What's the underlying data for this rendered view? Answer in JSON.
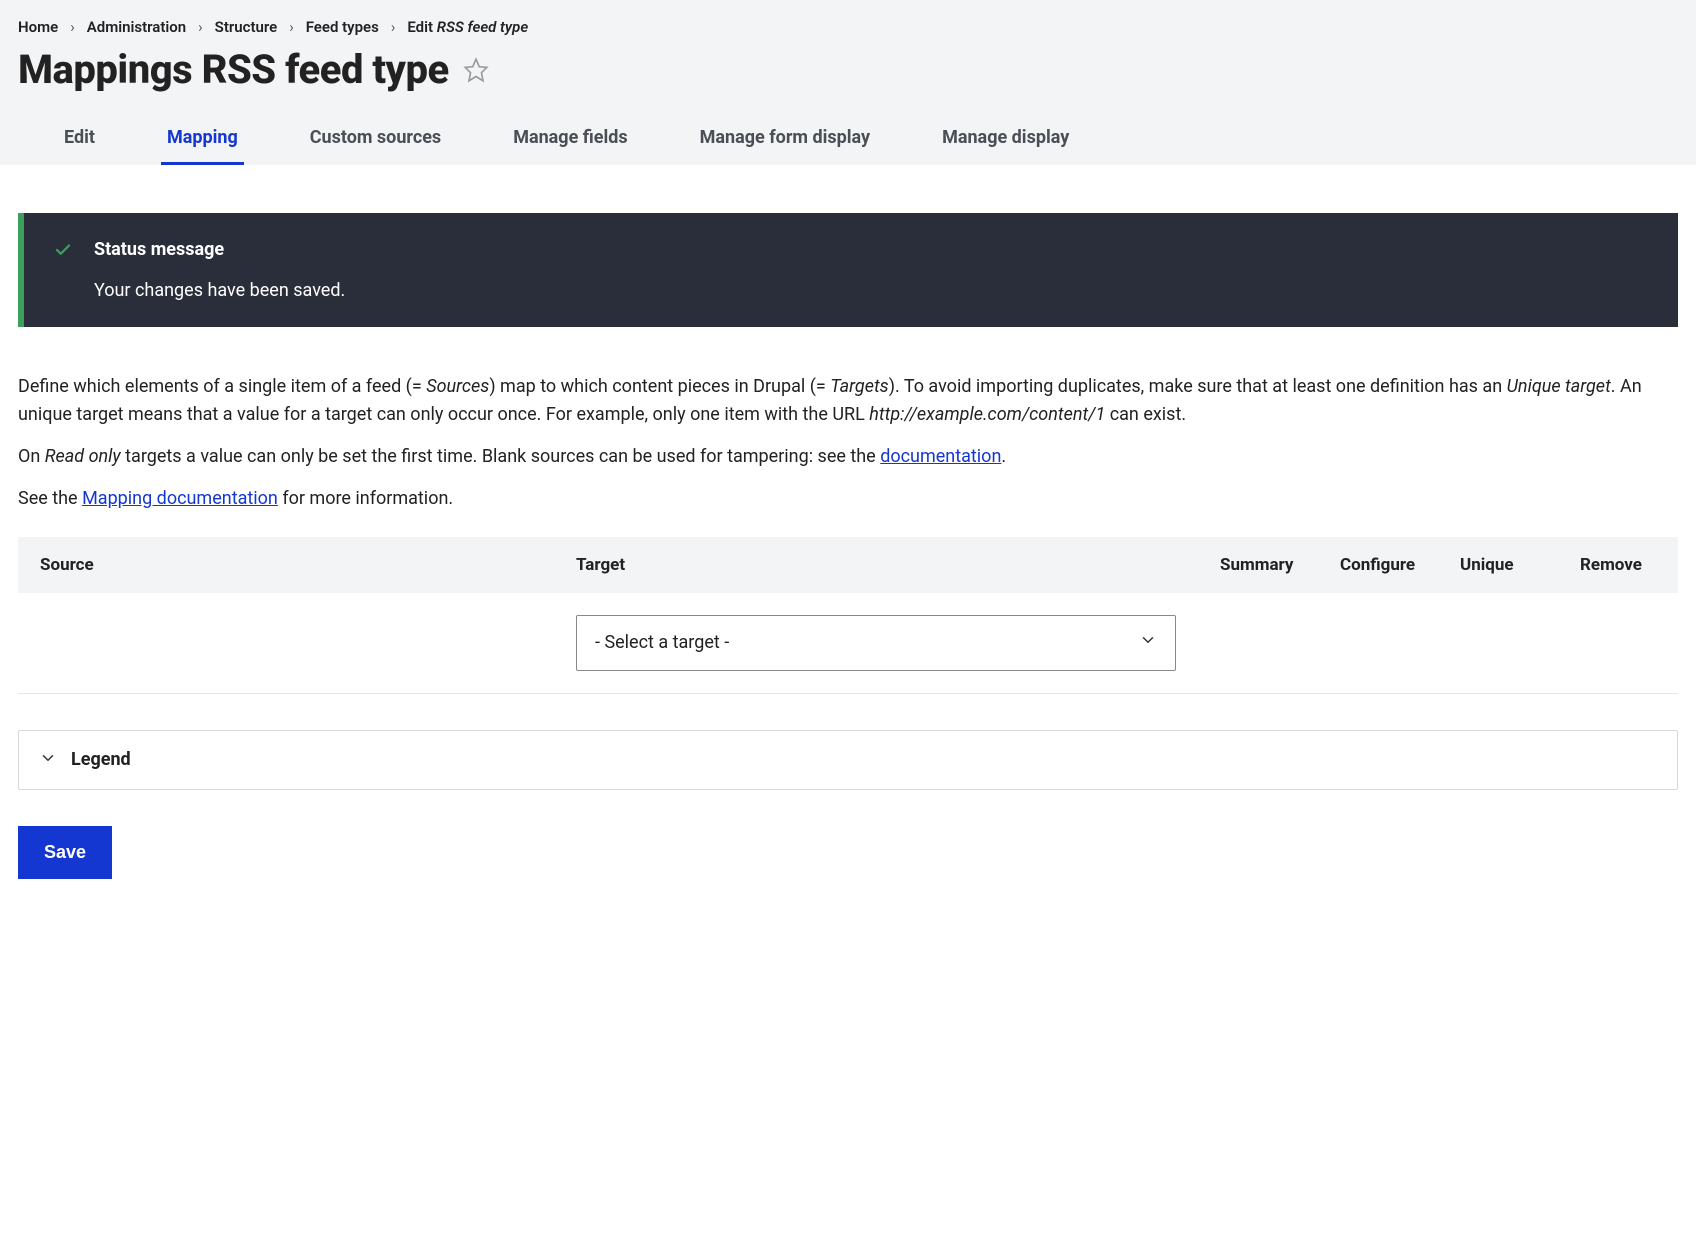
{
  "breadcrumb": {
    "items": [
      "Home",
      "Administration",
      "Structure",
      "Feed types"
    ],
    "current_prefix": "Edit ",
    "current_italic": "RSS feed type"
  },
  "page_title": "Mappings RSS feed type",
  "tabs": [
    {
      "label": "Edit",
      "active": false
    },
    {
      "label": "Mapping",
      "active": true
    },
    {
      "label": "Custom sources",
      "active": false
    },
    {
      "label": "Manage fields",
      "active": false
    },
    {
      "label": "Manage form display",
      "active": false
    },
    {
      "label": "Manage display",
      "active": false
    }
  ],
  "status": {
    "title": "Status message",
    "text": "Your changes have been saved."
  },
  "desc": {
    "p1_a": "Define which elements of a single item of a feed (= ",
    "p1_b": "Sources",
    "p1_c": ") map to which content pieces in Drupal (= ",
    "p1_d": "Targets",
    "p1_e": "). To avoid importing duplicates, make sure that at least one definition has an ",
    "p1_f": "Unique target",
    "p1_g": ". An unique target means that a value for a target can only occur once. For example, only one item with the URL ",
    "p1_h": "http://example.com/content/1",
    "p1_i": " can exist.",
    "p2_a": "On ",
    "p2_b": "Read only",
    "p2_c": " targets a value can only be set the first time. Blank sources can be used for tampering: see the ",
    "p2_link": "documentation",
    "p2_d": ".",
    "p3_a": "See the ",
    "p3_link": "Mapping documentation",
    "p3_b": " for more information."
  },
  "table": {
    "headers": {
      "source": "Source",
      "target": "Target",
      "summary": "Summary",
      "configure": "Configure",
      "unique": "Unique",
      "remove": "Remove"
    },
    "select_placeholder": "- Select a target -"
  },
  "legend": {
    "title": "Legend"
  },
  "buttons": {
    "save": "Save"
  }
}
